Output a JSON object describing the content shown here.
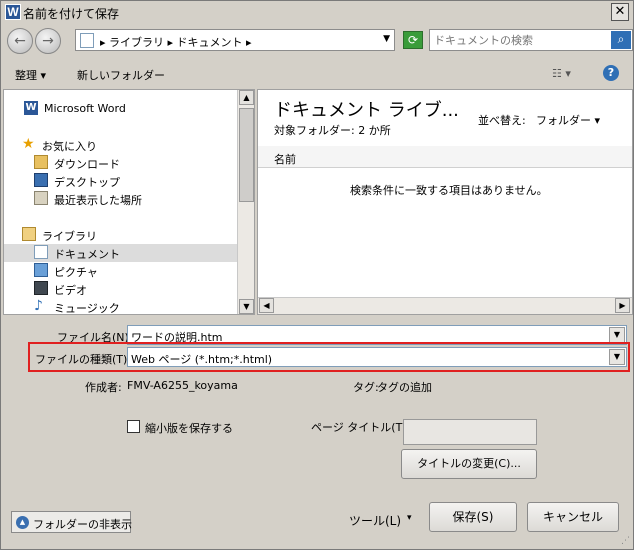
{
  "window": {
    "title": "名前を付けて保存",
    "app_icon": "W",
    "close": "✕"
  },
  "nav": {
    "back": "←",
    "forward": "→",
    "breadcrumb": "▸ ライブラリ ▸ ドキュメント ▸",
    "refresh": "⟳",
    "search_placeholder": "ドキュメントの検索",
    "search_icon": "⌕"
  },
  "toolbar": {
    "organize": "整理 ▾",
    "new_folder": "新しいフォルダー",
    "view_icon": "☷ ▾",
    "help": "?"
  },
  "sidebar": {
    "items": [
      {
        "label": "Microsoft Word",
        "icon": "word-icon"
      },
      {
        "label": "お気に入り",
        "icon": "star-icon"
      },
      {
        "label": "ダウンロード",
        "icon": "folder-download-icon"
      },
      {
        "label": "デスクトップ",
        "icon": "desktop-icon"
      },
      {
        "label": "最近表示した場所",
        "icon": "recent-places-icon"
      },
      {
        "label": "ライブラリ",
        "icon": "library-icon"
      },
      {
        "label": "ドキュメント",
        "icon": "document-icon",
        "selected": true
      },
      {
        "label": "ピクチャ",
        "icon": "picture-icon"
      },
      {
        "label": "ビデオ",
        "icon": "video-icon"
      },
      {
        "label": "ミュージック",
        "icon": "music-icon"
      }
    ]
  },
  "content": {
    "title": "ドキュメント ライブ...",
    "subtitle": "対象フォルダー: 2 か所",
    "sort_label": "並べ替え:",
    "sort_value": "フォルダー ▾",
    "column_name": "名前",
    "empty_message": "検索条件に一致する項目はありません。"
  },
  "form": {
    "filename_label": "ファイル名(N):",
    "filename_value": "ワードの説明.htm",
    "filetype_label": "ファイルの種類(T):",
    "filetype_value": "Web ページ (*.htm;*.html)",
    "author_label": "作成者:",
    "author_value": "FMV-A6255_koyama",
    "tags_label": "タグ:",
    "tags_value": "タグの追加",
    "thumbnail_label": "縮小版を保存する",
    "page_title_label": "ページ タイトル(T):",
    "change_title_button": "タイトルの変更(C)..."
  },
  "footer": {
    "hide_folders": "フォルダーの非表示",
    "tools": "ツール(L)",
    "tools_arrow": "▾",
    "save": "保存(S)",
    "cancel": "キャンセル"
  },
  "colors": {
    "highlight": "#e02020",
    "accent": "#2f6fb5"
  }
}
